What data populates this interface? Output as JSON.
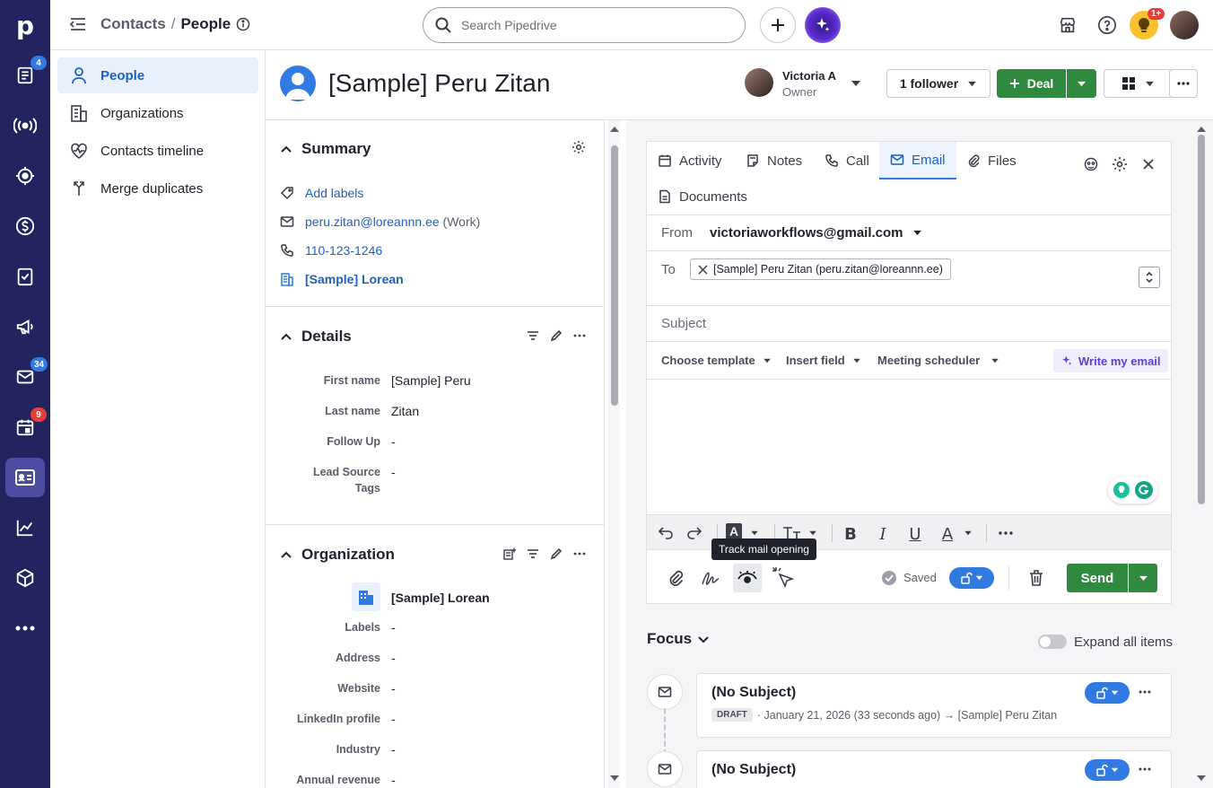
{
  "rail": {
    "logo": "p",
    "items": [
      {
        "icon": "leads-icon",
        "badge": "4"
      },
      {
        "icon": "campaigns-icon"
      },
      {
        "icon": "goals-icon"
      },
      {
        "icon": "deals-icon"
      },
      {
        "icon": "tasks-icon"
      },
      {
        "icon": "marketing-icon"
      },
      {
        "icon": "mail-icon",
        "badge": "34"
      },
      {
        "icon": "calendar-icon",
        "badge": "9"
      },
      {
        "icon": "contacts-icon"
      },
      {
        "icon": "insights-icon"
      },
      {
        "icon": "products-icon"
      },
      {
        "icon": "more-icon"
      }
    ]
  },
  "topbar": {
    "breadcrumb_parent": "Contacts",
    "breadcrumb_sep": "/",
    "breadcrumb_current": "People",
    "search_placeholder": "Search Pipedrive",
    "tips_badge": "1+"
  },
  "subnav": {
    "items": [
      {
        "label": "People",
        "icon": "person-icon"
      },
      {
        "label": "Organizations",
        "icon": "building-icon"
      },
      {
        "label": "Contacts timeline",
        "icon": "heart-pulse-icon"
      },
      {
        "label": "Merge duplicates",
        "icon": "merge-icon"
      }
    ]
  },
  "person": {
    "name": "[Sample] Peru Zitan",
    "owner_name": "Victoria A",
    "owner_role": "Owner",
    "follower_label": "1 follower",
    "deal_label": "Deal"
  },
  "summary": {
    "title": "Summary",
    "add_labels": "Add labels",
    "email": "peru.zitan@loreannn.ee",
    "email_type": "(Work)",
    "phone": "110-123-1246",
    "organization": "[Sample] Lorean"
  },
  "details": {
    "title": "Details",
    "fields": [
      {
        "label": "First name",
        "value": "[Sample] Peru"
      },
      {
        "label": "Last name",
        "value": "Zitan"
      },
      {
        "label": "Follow Up",
        "value": "-"
      },
      {
        "label": "Lead Source",
        "label2": "Tags",
        "value": "-"
      }
    ]
  },
  "organization": {
    "title": "Organization",
    "name": "[Sample] Lorean",
    "fields": [
      {
        "label": "Labels",
        "value": "-"
      },
      {
        "label": "Address",
        "value": "-"
      },
      {
        "label": "Website",
        "value": "-"
      },
      {
        "label": "LinkedIn profile",
        "value": "-"
      },
      {
        "label": "Industry",
        "value": "-"
      },
      {
        "label": "Annual revenue",
        "value": "-"
      }
    ]
  },
  "composer": {
    "tabs": [
      "Activity",
      "Notes",
      "Call",
      "Email",
      "Files",
      "Documents"
    ],
    "active_tab": "Email",
    "from_label": "From",
    "from_value": "victoriaworkflows@gmail.com",
    "to_label": "To",
    "to_chip": "[Sample] Peru Zitan (peru.zitan@loreannn.ee)",
    "subject_placeholder": "Subject",
    "choose_template": "Choose template",
    "insert_field": "Insert field",
    "meeting_scheduler": "Meeting scheduler",
    "write_my_email": "Write my email",
    "tooltip": "Track mail opening",
    "saved": "Saved",
    "send": "Send"
  },
  "focus": {
    "title": "Focus",
    "expand_label": "Expand all items",
    "items": [
      {
        "title": "(No Subject)",
        "tag": "DRAFT",
        "meta": "· January 21, 2026 (33 seconds ago) → [Sample] Peru Zitan"
      },
      {
        "title": "(No Subject)"
      }
    ]
  },
  "colors": {
    "rail_bg": "#23235f",
    "accent_blue": "#317ae2",
    "green": "#2f8a3f",
    "ai_purple": "#5b3fd6"
  }
}
